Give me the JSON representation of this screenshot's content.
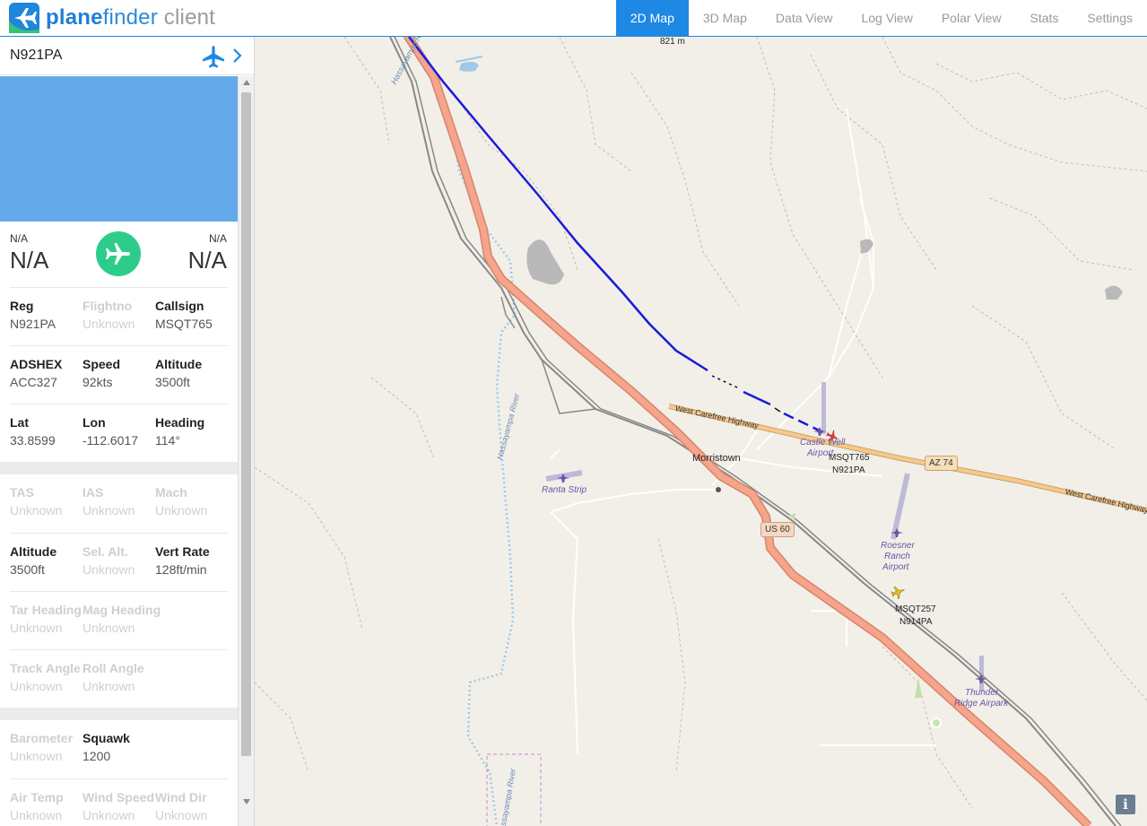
{
  "app": {
    "logo_bold": "plane",
    "logo_mid": "finder",
    "logo_suffix": " client"
  },
  "nav": {
    "tabs": [
      "2D Map",
      "3D Map",
      "Data View",
      "Log View",
      "Polar View",
      "Stats",
      "Settings"
    ],
    "active": "2D Map"
  },
  "sidebar": {
    "title": "N921PA",
    "route": {
      "left_small": "N/A",
      "left_big": "N/A",
      "right_small": "N/A",
      "right_big": "N/A"
    },
    "groups": [
      [
        [
          {
            "label": "Reg",
            "value": "N921PA",
            "dim": false
          },
          {
            "label": "Flightno",
            "value": "Unknown",
            "dim": true
          },
          {
            "label": "Callsign",
            "value": "MSQT765",
            "dim": false
          }
        ],
        [
          {
            "label": "ADSHEX",
            "value": "ACC327",
            "dim": false
          },
          {
            "label": "Speed",
            "value": "92kts",
            "dim": false
          },
          {
            "label": "Altitude",
            "value": "3500ft",
            "dim": false
          }
        ],
        [
          {
            "label": "Lat",
            "value": "33.8599",
            "dim": false
          },
          {
            "label": "Lon",
            "value": "-112.6017",
            "dim": false
          },
          {
            "label": "Heading",
            "value": "114°",
            "dim": false
          }
        ]
      ],
      [
        [
          {
            "label": "TAS",
            "value": "Unknown",
            "dim": true
          },
          {
            "label": "IAS",
            "value": "Unknown",
            "dim": true
          },
          {
            "label": "Mach",
            "value": "Unknown",
            "dim": true
          }
        ],
        [
          {
            "label": "Altitude",
            "value": "3500ft",
            "dim": false
          },
          {
            "label": "Sel. Alt.",
            "value": "Unknown",
            "dim": true
          },
          {
            "label": "Vert Rate",
            "value": "128ft/min",
            "dim": false
          }
        ],
        [
          {
            "label": "Tar Heading",
            "value": "Unknown",
            "dim": true
          },
          {
            "label": "Mag Heading",
            "value": "Unknown",
            "dim": true
          }
        ],
        [
          {
            "label": "Track Angle",
            "value": "Unknown",
            "dim": true
          },
          {
            "label": "Roll Angle",
            "value": "Unknown",
            "dim": true
          }
        ]
      ],
      [
        [
          {
            "label": "Barometer",
            "value": "Unknown",
            "dim": true
          },
          {
            "label": "Squawk",
            "value": "1200",
            "dim": false
          }
        ],
        [
          {
            "label": "Air Temp",
            "value": "Unknown",
            "dim": true
          },
          {
            "label": "Wind Speed",
            "value": "Unknown",
            "dim": true
          },
          {
            "label": "Wind Dir",
            "value": "Unknown",
            "dim": true
          }
        ]
      ]
    ]
  },
  "map": {
    "elevation_label": "821 m",
    "town": "Morristown",
    "road_west_carefree_1": "West Carefree Highway",
    "road_west_carefree_2": "West Carefree Highway",
    "shield_us60": "US 60",
    "shield_az74": "AZ 74",
    "river_1": "Hassayampa River",
    "river_2": "Hassayampa River",
    "river_3": "Hassayampa River",
    "airports": {
      "ranta": "Ranta Strip",
      "castle_well_1": "Castle Well",
      "castle_well_2": "Airport",
      "roesner_1": "Roesner",
      "roesner_2": "Ranch",
      "roesner_3": "Airport",
      "thunder_1": "Thunder",
      "thunder_2": "Ridge Airpark"
    },
    "aircraft": [
      {
        "callsign": "MSQT765",
        "reg": "N921PA"
      },
      {
        "callsign": "MSQT257",
        "reg": "N914PA"
      }
    ],
    "info_label": "i",
    "colors": {
      "track": "#1a1adc",
      "highway": "#e89a82",
      "secondary": "#f6c98a",
      "water": "#9fc9e6",
      "land": "#f2efe9"
    }
  }
}
